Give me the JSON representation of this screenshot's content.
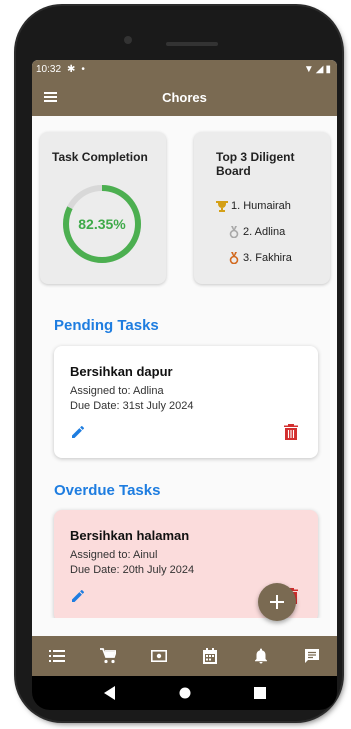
{
  "status_bar": {
    "time": "10:32"
  },
  "app_bar": {
    "title": "Chores"
  },
  "completion_card": {
    "title": "Task Completion",
    "percent_label": "82.35%",
    "percent_value": 82.35,
    "ring_color": "#4caf50"
  },
  "leaderboard": {
    "title": "Top 3 Diligent Board",
    "entries": [
      {
        "label": "1. Humairah",
        "medal_icon": "gold-trophy-icon",
        "color": "#d4a017"
      },
      {
        "label": "2. Adlina",
        "medal_icon": "silver-medal-icon",
        "color": "#a8a8a8"
      },
      {
        "label": "3. Fakhira",
        "medal_icon": "bronze-medal-icon",
        "color": "#d2691e"
      }
    ]
  },
  "pending": {
    "section_title": "Pending Tasks",
    "task": {
      "name": "Bersihkan dapur",
      "assigned": "Assigned to: Adlina",
      "due": "Due Date: 31st July 2024"
    }
  },
  "overdue": {
    "section_title": "Overdue Tasks",
    "task": {
      "name": "Bersihkan halaman",
      "assigned": "Assigned to: Ainul",
      "due": "Due Date: 20th July 2024"
    }
  },
  "colors": {
    "primary": "#7a6a52",
    "accent_blue": "#1e7de0",
    "delete_red": "#d32f2f",
    "overdue_bg": "#fbdcdc"
  },
  "bottom_nav_icons": [
    "list-icon",
    "cart-icon",
    "money-icon",
    "calendar-icon",
    "bell-icon",
    "message-icon"
  ]
}
